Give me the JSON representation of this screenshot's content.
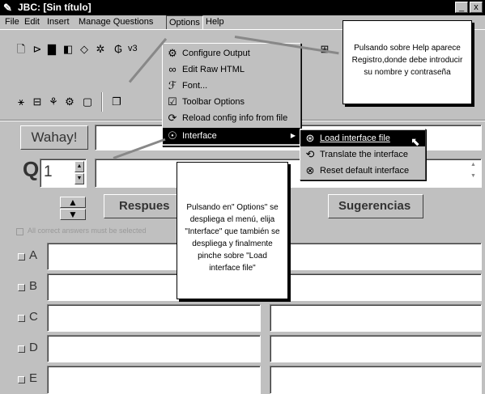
{
  "window": {
    "title": "JBC: [Sin título]",
    "minimize": "_",
    "close": "x"
  },
  "menubar": {
    "file": "File",
    "edit": "Edit",
    "insert": "Insert",
    "manage": "Manage Questions",
    "options": "Options",
    "help": "Help"
  },
  "toolbar": {
    "row1_icons": [
      "new-icon",
      "open-icon",
      "save-icon",
      "save-as-icon",
      "html-icon",
      "settings-icon",
      "export-icon"
    ],
    "version_label": "v3",
    "row2_icons": [
      "config-icon",
      "web-icon",
      "font-icon",
      "tools-icon",
      "image-icon",
      "book-icon"
    ]
  },
  "options_menu": {
    "items": [
      {
        "label": "Configure Output",
        "icon": "configure-icon"
      },
      {
        "label": "Edit Raw HTML",
        "icon": "glasses-icon"
      },
      {
        "label": "Font...",
        "icon": "font-icon"
      },
      {
        "label": "Toolbar Options",
        "icon": "checkbox-icon"
      },
      {
        "label": "Reload config info from file",
        "icon": "reload-icon"
      },
      {
        "label": "Interface",
        "icon": "interface-icon",
        "arrow": "▶"
      }
    ]
  },
  "interface_submenu": {
    "items": [
      {
        "label": "Load interface file",
        "icon": "load-icon"
      },
      {
        "label": "Translate the interface",
        "icon": "translate-icon"
      },
      {
        "label": "Reset default interface",
        "icon": "reset-icon"
      }
    ]
  },
  "main": {
    "wahay": "Wahay!",
    "q_label": "Q",
    "q_number": "1",
    "respuestas": "Respues",
    "sugerencias": "Sugerencias",
    "all_correct": "All correct answers must be selected",
    "options": [
      "A",
      "B",
      "C",
      "D",
      "E"
    ]
  },
  "callouts": {
    "help": "Pulsando sobre Help aparece Registro,donde debe introducir su nombre y contraseña",
    "options": "Pulsando en\" Options\" se despliega el menú, elija \"Interface\" que también se despliega y finalmente pinche sobre \"Load interface file\""
  },
  "colors": {
    "highlight": "#000000",
    "window_bg": "#c0c0c0",
    "arrow": "#888888"
  }
}
